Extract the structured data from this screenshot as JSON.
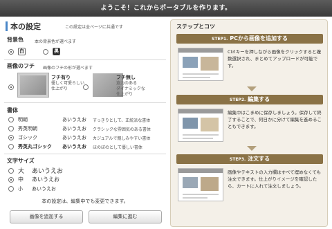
{
  "window": {
    "title": "ようこそ！これからポータブルを作ります。"
  },
  "settings": {
    "title": "本の設定",
    "note": "この設定は全ページに共通です",
    "bg": {
      "label": "背景色",
      "sub": "本の背景色が選べます",
      "options": [
        {
          "glyph": "白",
          "selected": true,
          "swatch": "#ffffff",
          "fg": "#333333"
        },
        {
          "glyph": "黒",
          "selected": false,
          "swatch": "#1a1a1a",
          "fg": "#ffffff"
        }
      ]
    },
    "frame": {
      "label": "画像のフチ",
      "sub": "画像のフチの形が選べます",
      "options": [
        {
          "title": "フチ有り",
          "desc1": "優しく可愛らしい",
          "desc2": "仕上がり",
          "selected": true
        },
        {
          "title": "フチ無し",
          "desc1": "迫力のある",
          "desc2": "ダイナミックな",
          "desc3": "仕上がり",
          "selected": false
        }
      ]
    },
    "font": {
      "label": "書体",
      "options": [
        {
          "name": "明朝",
          "sample": "あいうえお",
          "desc": "すっきりとして、正統派な書体",
          "selected": false
        },
        {
          "name": "秀英明朝",
          "sample": "あいうえお",
          "desc": "クラシックな雰囲気のある書体",
          "selected": false
        },
        {
          "name": "ゴシック",
          "sample": "あいうえお",
          "desc": "カジュアルで親しみやすい書体",
          "selected": true
        },
        {
          "name": "秀英丸ゴシック",
          "sample": "あいうえお",
          "desc": "ほのぼのとして優しい書体",
          "selected": false
        }
      ]
    },
    "size": {
      "label": "文字サイズ",
      "options": [
        {
          "name": "大",
          "sample": "あいうえお",
          "selected": false
        },
        {
          "name": "中",
          "sample": "あいうえお",
          "selected": true
        },
        {
          "name": "小",
          "sample": "あいうえお",
          "selected": false
        }
      ]
    },
    "bottom_note": "本の設定は、編集中でも変更できます。",
    "add_images_button": "画像を追加する",
    "next_button": "編集に進む"
  },
  "tips": {
    "title": "ステップとコツ",
    "steps": [
      {
        "small": "STEP1.",
        "big": " PCから画像を追加する",
        "text": "Ctrlキーを押しながら画像をクリックすると複数選択され、まとめてアップロードが可能です。"
      },
      {
        "small": "STEP2.",
        "big": " 編集する",
        "text": "編集中はこまめに保存しましょう。保存して終了することで、何日かに分けて編集を進めることもできます。"
      },
      {
        "small": "STEP3.",
        "big": " 注文する",
        "text": "画像やテキストの入力欄はすべて埋めなくても注文できます。仕上がりイメージを確認したら、カートに入れて注文しましょう。"
      }
    ]
  }
}
